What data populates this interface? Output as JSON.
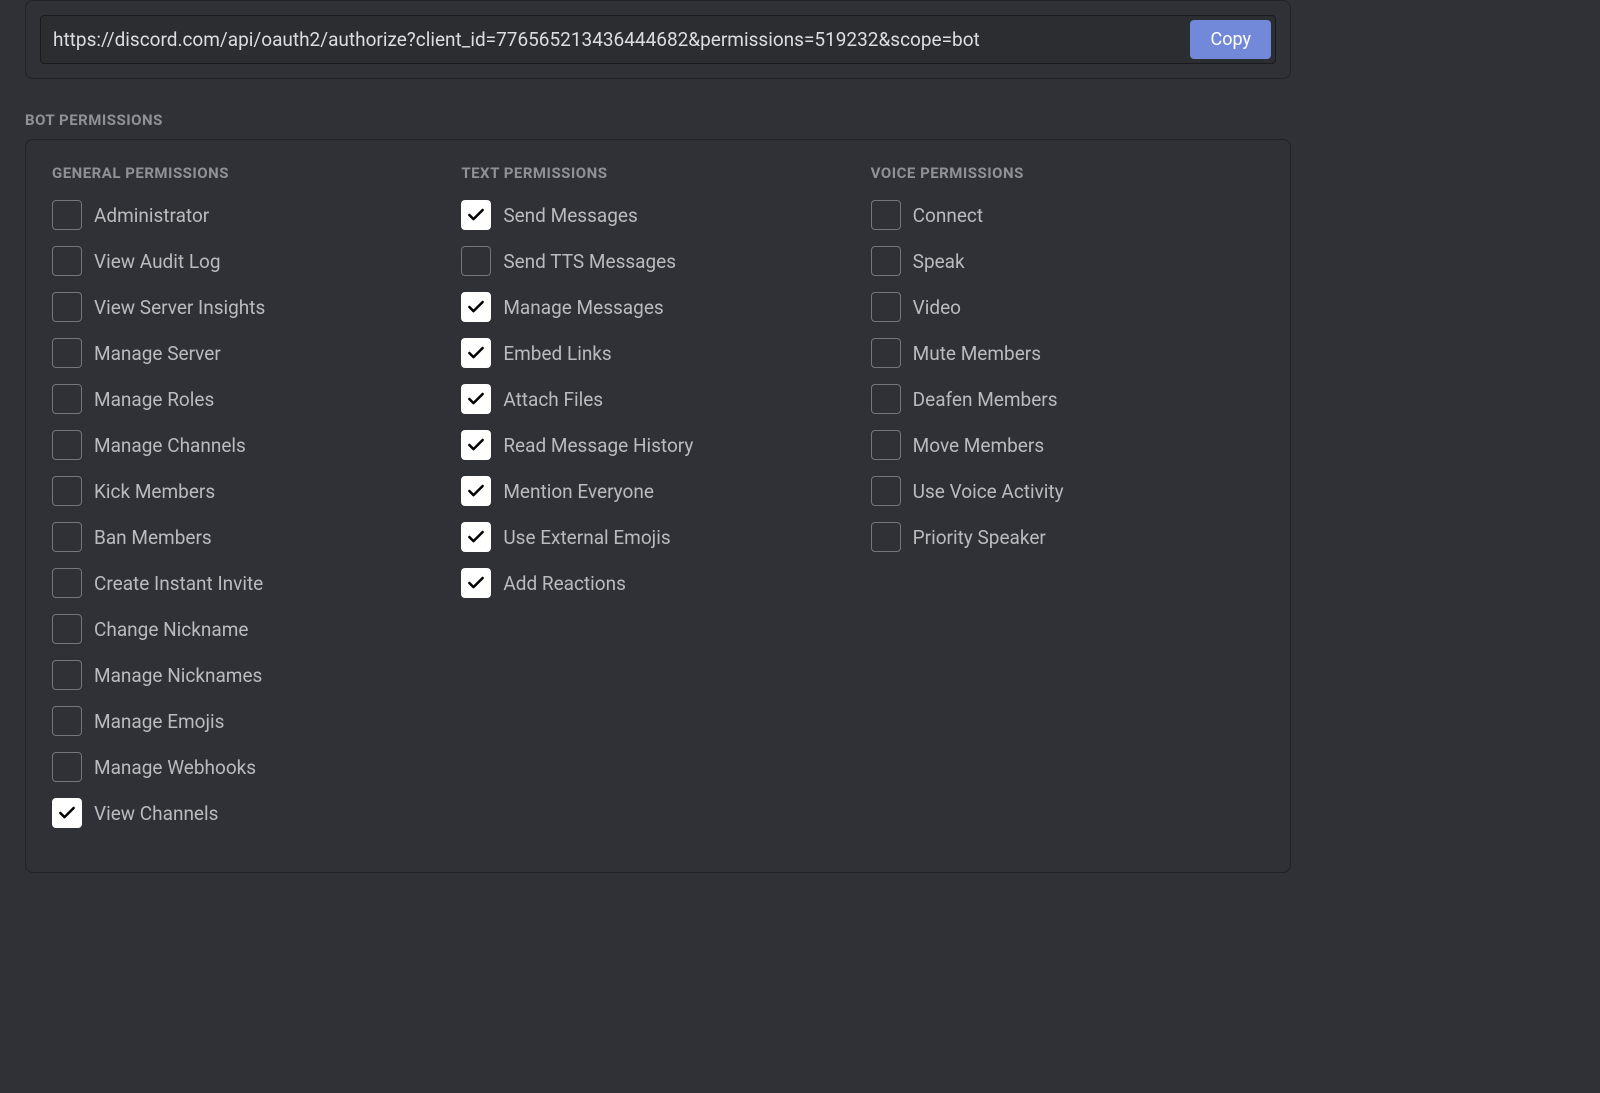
{
  "url_section": {
    "url": "https://discord.com/api/oauth2/authorize?client_id=776565213436444682&permissions=519232&scope=bot",
    "copy_label": "Copy"
  },
  "section_title": "BOT PERMISSIONS",
  "columns": [
    {
      "header": "GENERAL PERMISSIONS",
      "items": [
        {
          "label": "Administrator",
          "checked": false
        },
        {
          "label": "View Audit Log",
          "checked": false
        },
        {
          "label": "View Server Insights",
          "checked": false
        },
        {
          "label": "Manage Server",
          "checked": false
        },
        {
          "label": "Manage Roles",
          "checked": false
        },
        {
          "label": "Manage Channels",
          "checked": false
        },
        {
          "label": "Kick Members",
          "checked": false
        },
        {
          "label": "Ban Members",
          "checked": false
        },
        {
          "label": "Create Instant Invite",
          "checked": false
        },
        {
          "label": "Change Nickname",
          "checked": false
        },
        {
          "label": "Manage Nicknames",
          "checked": false
        },
        {
          "label": "Manage Emojis",
          "checked": false
        },
        {
          "label": "Manage Webhooks",
          "checked": false
        },
        {
          "label": "View Channels",
          "checked": true
        }
      ]
    },
    {
      "header": "TEXT PERMISSIONS",
      "items": [
        {
          "label": "Send Messages",
          "checked": true
        },
        {
          "label": "Send TTS Messages",
          "checked": false
        },
        {
          "label": "Manage Messages",
          "checked": true
        },
        {
          "label": "Embed Links",
          "checked": true
        },
        {
          "label": "Attach Files",
          "checked": true
        },
        {
          "label": "Read Message History",
          "checked": true
        },
        {
          "label": "Mention Everyone",
          "checked": true
        },
        {
          "label": "Use External Emojis",
          "checked": true
        },
        {
          "label": "Add Reactions",
          "checked": true
        }
      ]
    },
    {
      "header": "VOICE PERMISSIONS",
      "items": [
        {
          "label": "Connect",
          "checked": false
        },
        {
          "label": "Speak",
          "checked": false
        },
        {
          "label": "Video",
          "checked": false
        },
        {
          "label": "Mute Members",
          "checked": false
        },
        {
          "label": "Deafen Members",
          "checked": false
        },
        {
          "label": "Move Members",
          "checked": false
        },
        {
          "label": "Use Voice Activity",
          "checked": false
        },
        {
          "label": "Priority Speaker",
          "checked": false
        }
      ]
    }
  ]
}
